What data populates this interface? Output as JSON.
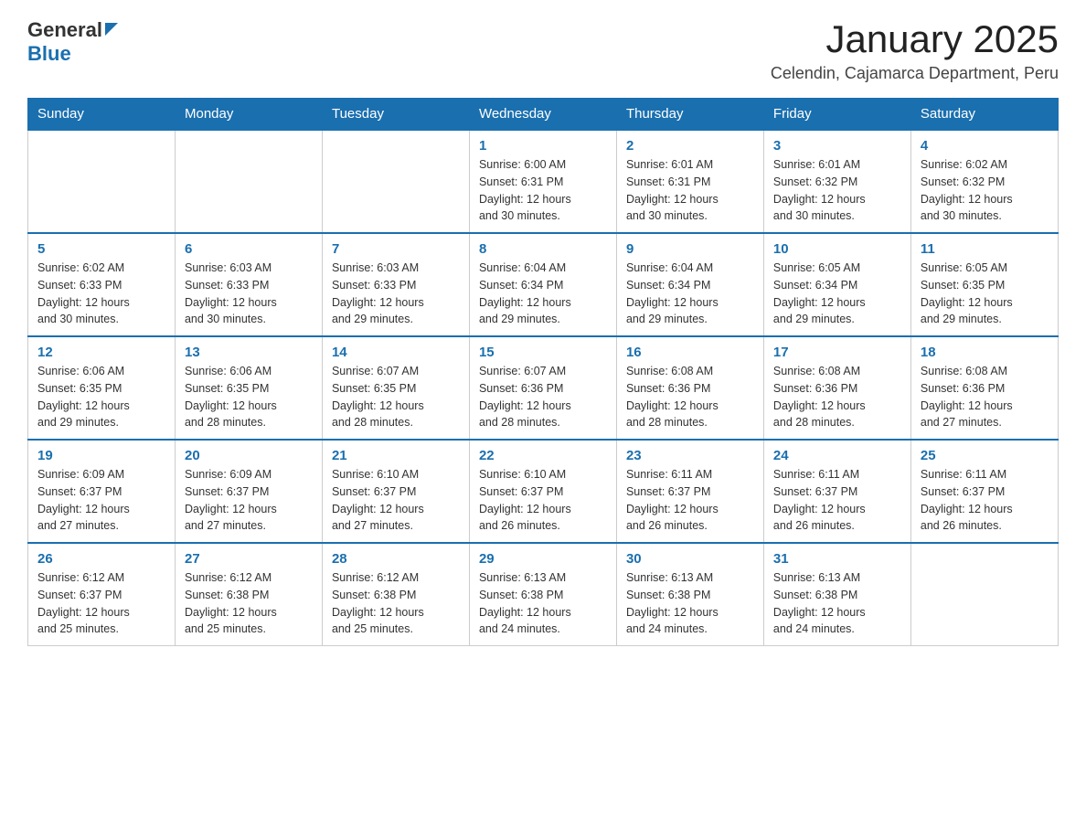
{
  "header": {
    "logo": {
      "general": "General",
      "triangle": "▲",
      "blue": "Blue"
    },
    "title": "January 2025",
    "subtitle": "Celendin, Cajamarca Department, Peru"
  },
  "weekdays": [
    "Sunday",
    "Monday",
    "Tuesday",
    "Wednesday",
    "Thursday",
    "Friday",
    "Saturday"
  ],
  "weeks": [
    [
      {
        "day": "",
        "info": ""
      },
      {
        "day": "",
        "info": ""
      },
      {
        "day": "",
        "info": ""
      },
      {
        "day": "1",
        "info": "Sunrise: 6:00 AM\nSunset: 6:31 PM\nDaylight: 12 hours\nand 30 minutes."
      },
      {
        "day": "2",
        "info": "Sunrise: 6:01 AM\nSunset: 6:31 PM\nDaylight: 12 hours\nand 30 minutes."
      },
      {
        "day": "3",
        "info": "Sunrise: 6:01 AM\nSunset: 6:32 PM\nDaylight: 12 hours\nand 30 minutes."
      },
      {
        "day": "4",
        "info": "Sunrise: 6:02 AM\nSunset: 6:32 PM\nDaylight: 12 hours\nand 30 minutes."
      }
    ],
    [
      {
        "day": "5",
        "info": "Sunrise: 6:02 AM\nSunset: 6:33 PM\nDaylight: 12 hours\nand 30 minutes."
      },
      {
        "day": "6",
        "info": "Sunrise: 6:03 AM\nSunset: 6:33 PM\nDaylight: 12 hours\nand 30 minutes."
      },
      {
        "day": "7",
        "info": "Sunrise: 6:03 AM\nSunset: 6:33 PM\nDaylight: 12 hours\nand 29 minutes."
      },
      {
        "day": "8",
        "info": "Sunrise: 6:04 AM\nSunset: 6:34 PM\nDaylight: 12 hours\nand 29 minutes."
      },
      {
        "day": "9",
        "info": "Sunrise: 6:04 AM\nSunset: 6:34 PM\nDaylight: 12 hours\nand 29 minutes."
      },
      {
        "day": "10",
        "info": "Sunrise: 6:05 AM\nSunset: 6:34 PM\nDaylight: 12 hours\nand 29 minutes."
      },
      {
        "day": "11",
        "info": "Sunrise: 6:05 AM\nSunset: 6:35 PM\nDaylight: 12 hours\nand 29 minutes."
      }
    ],
    [
      {
        "day": "12",
        "info": "Sunrise: 6:06 AM\nSunset: 6:35 PM\nDaylight: 12 hours\nand 29 minutes."
      },
      {
        "day": "13",
        "info": "Sunrise: 6:06 AM\nSunset: 6:35 PM\nDaylight: 12 hours\nand 28 minutes."
      },
      {
        "day": "14",
        "info": "Sunrise: 6:07 AM\nSunset: 6:35 PM\nDaylight: 12 hours\nand 28 minutes."
      },
      {
        "day": "15",
        "info": "Sunrise: 6:07 AM\nSunset: 6:36 PM\nDaylight: 12 hours\nand 28 minutes."
      },
      {
        "day": "16",
        "info": "Sunrise: 6:08 AM\nSunset: 6:36 PM\nDaylight: 12 hours\nand 28 minutes."
      },
      {
        "day": "17",
        "info": "Sunrise: 6:08 AM\nSunset: 6:36 PM\nDaylight: 12 hours\nand 28 minutes."
      },
      {
        "day": "18",
        "info": "Sunrise: 6:08 AM\nSunset: 6:36 PM\nDaylight: 12 hours\nand 27 minutes."
      }
    ],
    [
      {
        "day": "19",
        "info": "Sunrise: 6:09 AM\nSunset: 6:37 PM\nDaylight: 12 hours\nand 27 minutes."
      },
      {
        "day": "20",
        "info": "Sunrise: 6:09 AM\nSunset: 6:37 PM\nDaylight: 12 hours\nand 27 minutes."
      },
      {
        "day": "21",
        "info": "Sunrise: 6:10 AM\nSunset: 6:37 PM\nDaylight: 12 hours\nand 27 minutes."
      },
      {
        "day": "22",
        "info": "Sunrise: 6:10 AM\nSunset: 6:37 PM\nDaylight: 12 hours\nand 26 minutes."
      },
      {
        "day": "23",
        "info": "Sunrise: 6:11 AM\nSunset: 6:37 PM\nDaylight: 12 hours\nand 26 minutes."
      },
      {
        "day": "24",
        "info": "Sunrise: 6:11 AM\nSunset: 6:37 PM\nDaylight: 12 hours\nand 26 minutes."
      },
      {
        "day": "25",
        "info": "Sunrise: 6:11 AM\nSunset: 6:37 PM\nDaylight: 12 hours\nand 26 minutes."
      }
    ],
    [
      {
        "day": "26",
        "info": "Sunrise: 6:12 AM\nSunset: 6:37 PM\nDaylight: 12 hours\nand 25 minutes."
      },
      {
        "day": "27",
        "info": "Sunrise: 6:12 AM\nSunset: 6:38 PM\nDaylight: 12 hours\nand 25 minutes."
      },
      {
        "day": "28",
        "info": "Sunrise: 6:12 AM\nSunset: 6:38 PM\nDaylight: 12 hours\nand 25 minutes."
      },
      {
        "day": "29",
        "info": "Sunrise: 6:13 AM\nSunset: 6:38 PM\nDaylight: 12 hours\nand 24 minutes."
      },
      {
        "day": "30",
        "info": "Sunrise: 6:13 AM\nSunset: 6:38 PM\nDaylight: 12 hours\nand 24 minutes."
      },
      {
        "day": "31",
        "info": "Sunrise: 6:13 AM\nSunset: 6:38 PM\nDaylight: 12 hours\nand 24 minutes."
      },
      {
        "day": "",
        "info": ""
      }
    ]
  ]
}
